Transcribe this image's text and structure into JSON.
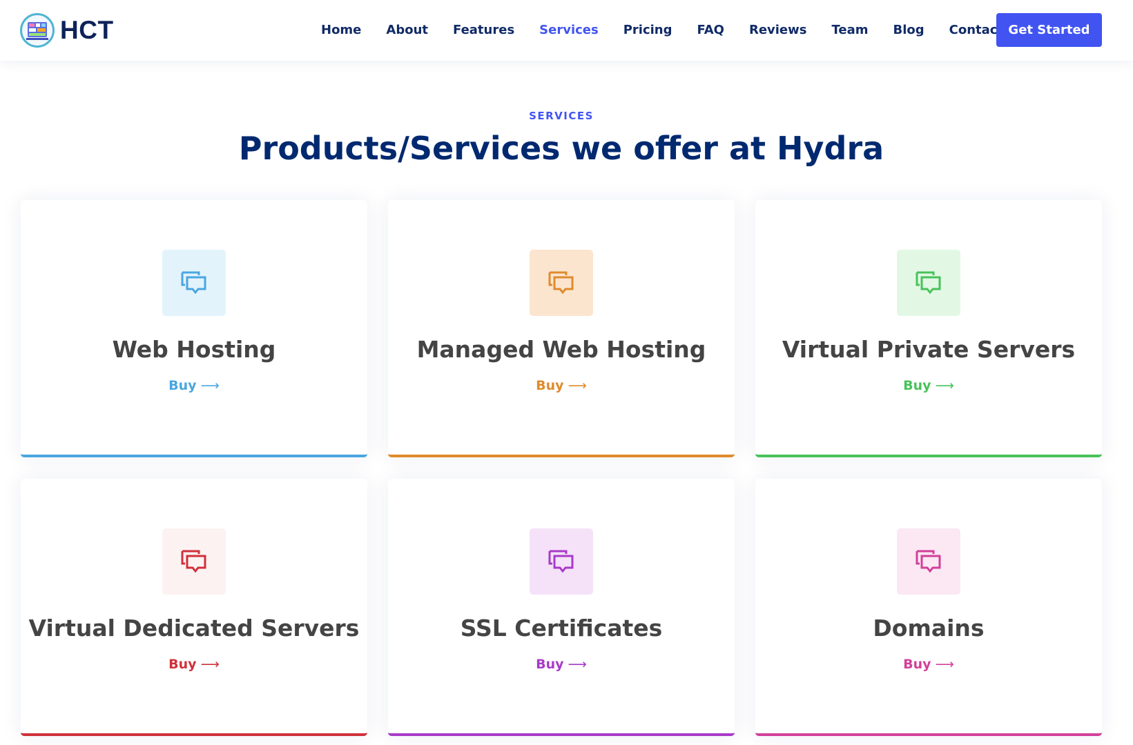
{
  "header": {
    "logo_text": "HCT",
    "nav": [
      "Home",
      "About",
      "Features",
      "Services",
      "Pricing",
      "FAQ",
      "Reviews",
      "Team",
      "Blog",
      "Contact"
    ],
    "active_nav": "Services",
    "cta_label": "Get Started"
  },
  "section": {
    "tag": "SERVICES",
    "title": "Products/Services we offer at Hydra"
  },
  "services": [
    {
      "title": "Web Hosting",
      "action": "Buy",
      "icon": "chat-bubbles-icon",
      "accent": "#4aa6e0",
      "tint": "#e3f3fc"
    },
    {
      "title": "Managed Web Hosting",
      "action": "Buy",
      "icon": "chat-bubbles-icon",
      "accent": "#e08a2c",
      "tint": "#fbe5cf"
    },
    {
      "title": "Virtual Private Servers",
      "action": "Buy",
      "icon": "chat-bubbles-icon",
      "accent": "#48c25a",
      "tint": "#e2f8e4"
    },
    {
      "title": "Virtual Dedicated Servers",
      "action": "Buy",
      "icon": "chat-bubbles-icon",
      "accent": "#d0303a",
      "tint": "#fcf2f2"
    },
    {
      "title": "SSL Certificates",
      "action": "Buy",
      "icon": "chat-bubbles-icon",
      "accent": "#a83ac8",
      "tint": "#f5e2f9"
    },
    {
      "title": "Domains",
      "action": "Buy",
      "icon": "chat-bubbles-icon",
      "accent": "#d23f9a",
      "tint": "#fbe8f3"
    }
  ],
  "colors": {
    "primary": "#4154f1",
    "heading": "#012970"
  }
}
